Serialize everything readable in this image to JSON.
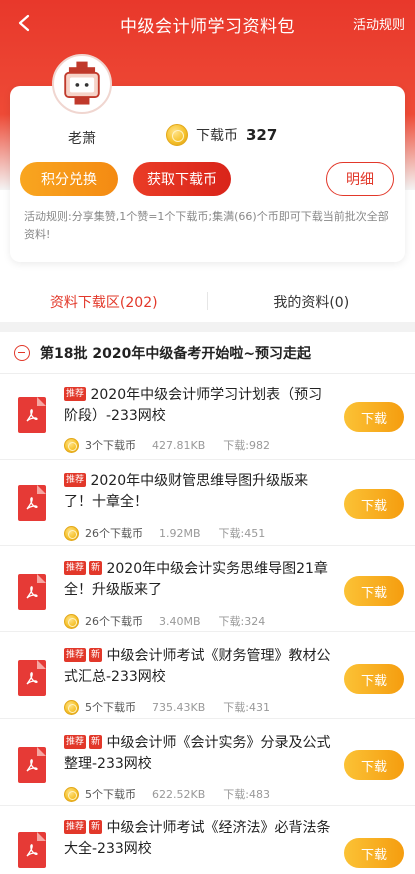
{
  "header": {
    "title": "中级会计师学习资料包",
    "rules_link": "活动规则"
  },
  "user": {
    "name": "老萧",
    "coin_label": "下载币",
    "coin_count": "327"
  },
  "buttons": {
    "points": "积分兑换",
    "get_coins": "获取下载币",
    "detail": "明细"
  },
  "rules": "活动规则:分享集赞,1个赞=1个下载币;集满(66)个币即可下载当前批次全部资料!",
  "tabs": [
    {
      "label": "资料下载区(202)",
      "active": true
    },
    {
      "label": "我的资料(0)",
      "active": false
    }
  ],
  "section": {
    "title": "第18批 2020年中级备考开始啦~预习走起"
  },
  "badges": {
    "hot": "推荐",
    "new": "新"
  },
  "download_label": "下载",
  "items": [
    {
      "title": "2020年中级会计师学习计划表（预习阶段）-233网校",
      "coins": "3个下载币",
      "size": "427.81KB",
      "downloads": "下载:982"
    },
    {
      "title": "2020年中级财管思维导图升级版来了！十章全！",
      "coins": "26个下载币",
      "size": "1.92MB",
      "downloads": "下载:451"
    },
    {
      "title": "2020年中级会计实务思维导图21章全！升级版来了",
      "coins": "26个下载币",
      "size": "3.40MB",
      "downloads": "下载:324"
    },
    {
      "title": "中级会计师考试《财务管理》教材公式汇总-233网校",
      "coins": "5个下载币",
      "size": "735.43KB",
      "downloads": "下载:431"
    },
    {
      "title": "中级会计师《会计实务》分录及公式整理-233网校",
      "coins": "5个下载币",
      "size": "622.52KB",
      "downloads": "下载:483"
    },
    {
      "title": "中级会计师考试《经济法》必背法条大全-233网校"
    }
  ],
  "colors": {
    "brand_red": "#e2382a",
    "accent_orange": "#f59d0f"
  }
}
